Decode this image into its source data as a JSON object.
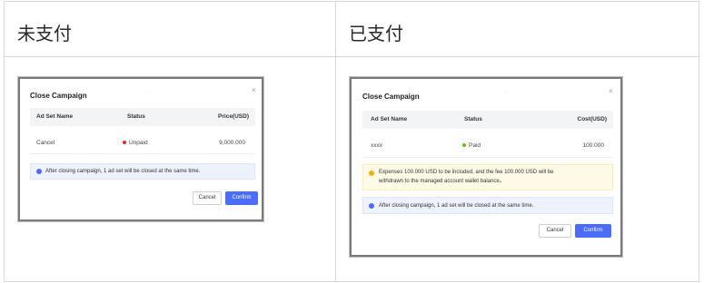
{
  "columns": [
    {
      "header": "未支付"
    },
    {
      "header": "已支付"
    }
  ],
  "unpaid_modal": {
    "title": "Close Campaign",
    "close_symbol": "×",
    "table_headers": [
      "Ad Set Name",
      "Status",
      "Price(USD)"
    ],
    "row": {
      "name": "Cancel",
      "status": "Unpaid",
      "value": "9,000.000"
    },
    "info_text": "After closing campaign, 1 ad set will be closed at the same time.",
    "cancel_label": "Cancel",
    "confirm_label": "Confirm"
  },
  "paid_modal": {
    "title": "Close Campaign",
    "close_symbol": "×",
    "table_headers": [
      "Ad Set Name",
      "Status",
      "Cost(USD)"
    ],
    "row": {
      "name": "xxxx",
      "status": "Paid",
      "value": "100.000"
    },
    "warn_line1": "Expenses 100.000 USD to be included, and the fee 100.000 USD will be",
    "warn_line2": "withdrawn to the managed account wallet balance。",
    "info_text": "After closing campaign, 1 ad set will be closed at the same time.",
    "cancel_label": "Cancel",
    "confirm_label": "Confirm"
  },
  "colors": {
    "accent": "#4a6cf7",
    "unpaid": "#f5222d",
    "paid": "#52c41a",
    "info_icon": "#4a6cf7",
    "warn_icon": "#faad14"
  }
}
